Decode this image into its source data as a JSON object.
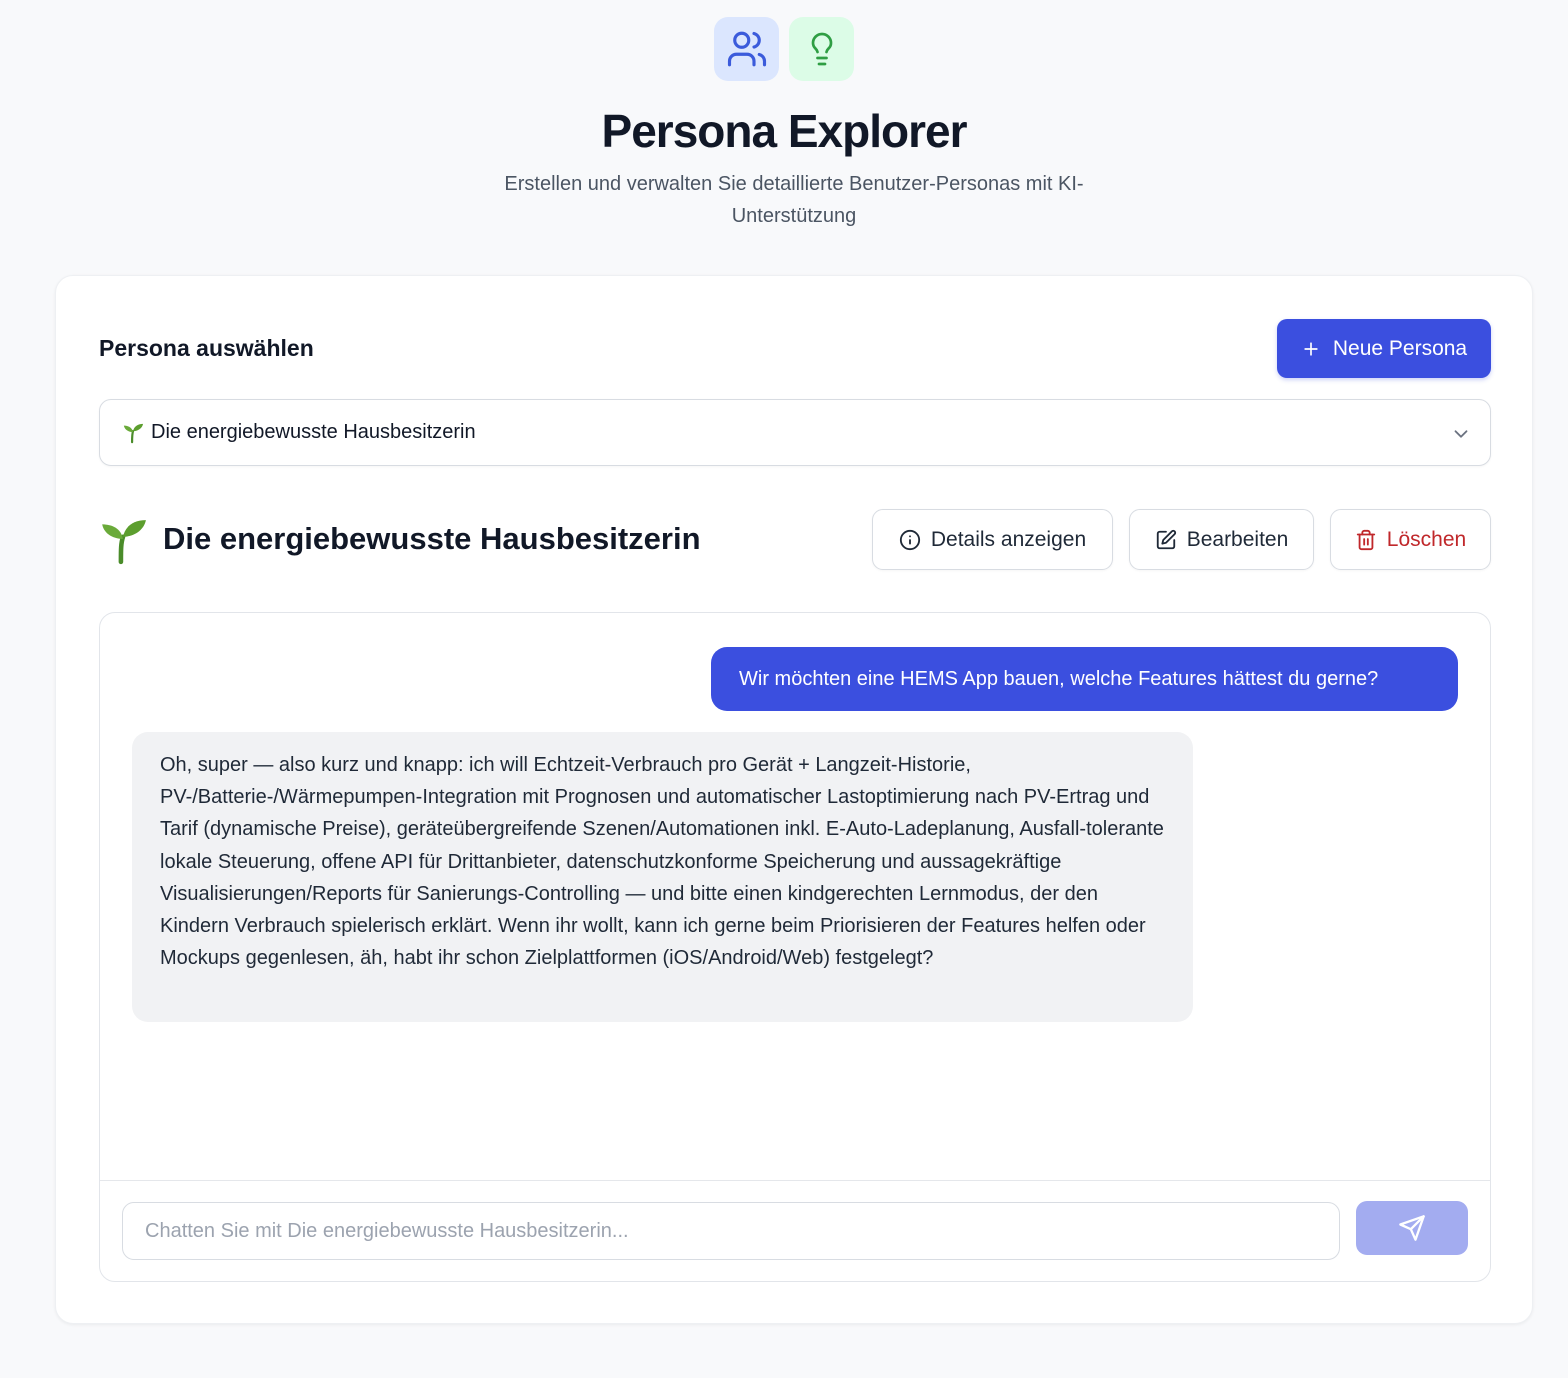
{
  "header": {
    "title": "Persona Explorer",
    "subtitle": "Erstellen und verwalten Sie detaillierte Benutzer-Personas mit KI-Unterstützung",
    "icons": [
      "users-icon",
      "lightbulb-icon"
    ]
  },
  "selector": {
    "label": "Persona auswählen",
    "new_button_label": "Neue Persona",
    "selected_value": "Die energiebewusste Hausbesitzerin",
    "selected_icon": "sprout-icon"
  },
  "persona": {
    "name": "Die energiebewusste Hausbesitzerin",
    "icon": "sprout-icon",
    "details_label": "Details anzeigen",
    "edit_label": "Bearbeiten",
    "delete_label": "Löschen"
  },
  "chat": {
    "messages": [
      {
        "role": "user",
        "text": "Wir möchten eine HEMS App bauen, welche Features hättest du gerne?"
      },
      {
        "role": "assistant",
        "text": "Oh, super — also kurz und knapp: ich will Echtzeit-Verbrauch pro Gerät + Langzeit-Historie, PV-/Batterie-/Wärmepumpen-Integration mit Prognosen und automatischer Lastoptimierung nach PV-Ertrag und Tarif (dynamische Preise), geräteübergreifende Szenen/Automationen inkl. E-Auto-Ladeplanung, Ausfall-tolerante lokale Steuerung, offene API für Drittanbieter, datenschutzkonforme Speicherung und aussagekräftige Visualisierungen/Reports für Sanierungs-Controlling — und bitte einen kindgerechten Lernmodus, der den Kindern Verbrauch spielerisch erklärt. Wenn ihr wollt, kann ich gerne beim Priorisieren der Features helfen oder Mockups gegenlesen, äh, habt ihr schon Zielplattformen (iOS/Android/Web) festgelegt?"
      }
    ],
    "input_placeholder": "Chatten Sie mit Die energiebewusste Hausbesitzerin...",
    "input_value": ""
  },
  "colors": {
    "accent": "#3b4fdf",
    "danger": "#c0282b",
    "send_disabled": "#a3acf0",
    "icon_blue_bg": "#dbe6fe",
    "icon_green_bg": "#dcfce7"
  }
}
